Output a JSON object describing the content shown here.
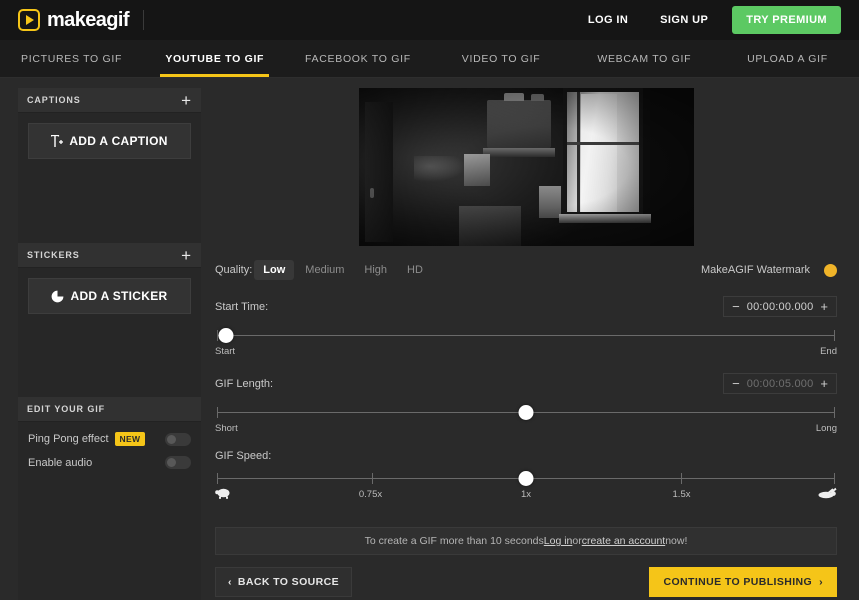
{
  "header": {
    "logo_icon": "play-square-icon",
    "logo_text": "makeagif",
    "login_label": "LOG IN",
    "signup_label": "SIGN UP",
    "premium_label": "TRY PREMIUM",
    "premium_color": "#5cc963"
  },
  "tabs": [
    {
      "label": "PICTURES TO GIF",
      "active": false
    },
    {
      "label": "YOUTUBE TO GIF",
      "active": true
    },
    {
      "label": "FACEBOOK TO GIF",
      "active": false
    },
    {
      "label": "VIDEO TO GIF",
      "active": false
    },
    {
      "label": "WEBCAM TO GIF",
      "active": false
    },
    {
      "label": "UPLOAD A GIF",
      "active": false
    }
  ],
  "sidebar": {
    "captions": {
      "title": "CAPTIONS",
      "add_icon": "plus-icon",
      "button_label": "ADD A CAPTION",
      "button_icon": "text-add-icon"
    },
    "stickers": {
      "title": "STICKERS",
      "add_icon": "plus-icon",
      "button_label": "ADD A STICKER",
      "button_icon": "sticker-icon"
    },
    "edit": {
      "title": "EDIT YOUR GIF",
      "rows": [
        {
          "label": "Ping Pong effect",
          "badge": "NEW",
          "toggle": "off"
        },
        {
          "label": "Enable audio",
          "badge": "",
          "toggle": "off"
        }
      ]
    }
  },
  "main": {
    "preview_alt": "dark room interior with bright curtained window",
    "quality": {
      "label": "Quality:",
      "options": [
        "Low",
        "Medium",
        "High",
        "HD"
      ],
      "selected": "Low"
    },
    "watermark": {
      "label": "MakeAGIF Watermark",
      "state": "on",
      "color": "#f0b429"
    },
    "start_time": {
      "label": "Start Time:",
      "value": "00:00:00.000",
      "minus": "−",
      "plus": "+",
      "axis_left": "Start",
      "axis_right": "End",
      "knob_pct": 1.5
    },
    "gif_length": {
      "label": "GIF Length:",
      "value": "00:00:05.000",
      "minus": "−",
      "plus": "+",
      "axis_left": "Short",
      "axis_right": "Long",
      "knob_pct": 50
    },
    "gif_speed": {
      "label": "GIF Speed:",
      "ticks": [
        {
          "label": "0.75x",
          "pct": 25
        },
        {
          "label": "1x",
          "pct": 50
        },
        {
          "label": "1.5x",
          "pct": 75
        }
      ],
      "slow_icon": "turtle-icon",
      "fast_icon": "rabbit-icon",
      "knob_pct": 50,
      "selected": "1x"
    },
    "notice": {
      "prefix": "To create a GIF more than 10 seconds ",
      "login_link": "Log in",
      "middle": " or ",
      "account_link": "create an account",
      "suffix": " now!"
    },
    "back_label": "BACK TO SOURCE",
    "back_icon": "chevron-left-icon",
    "continue_label": "CONTINUE TO PUBLISHING",
    "continue_icon": "chevron-right-icon",
    "continue_color": "#f5c518"
  }
}
